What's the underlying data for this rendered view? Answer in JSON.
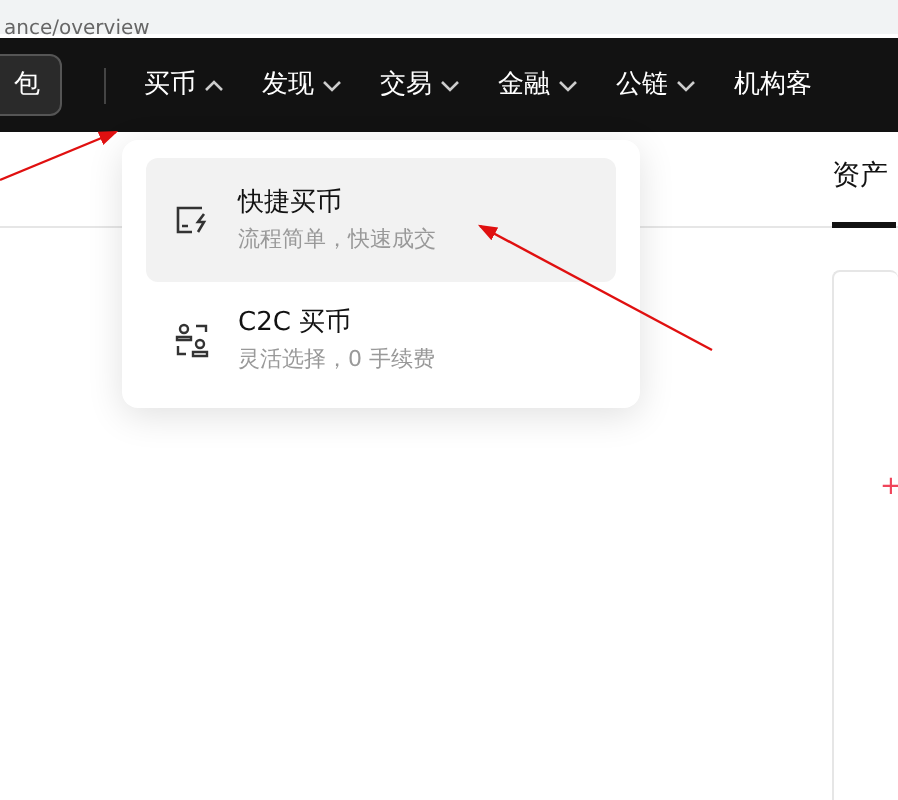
{
  "address_bar": {
    "url": "ance/overview"
  },
  "navbar": {
    "wallet_button": "包",
    "items": [
      {
        "label": "买币",
        "expanded": true
      },
      {
        "label": "发现",
        "expanded": false
      },
      {
        "label": "交易",
        "expanded": false
      },
      {
        "label": "金融",
        "expanded": false
      },
      {
        "label": "公链",
        "expanded": false
      },
      {
        "label": "机构客"
      }
    ]
  },
  "dropdown": {
    "items": [
      {
        "kind": "quick",
        "title": "快捷买币",
        "subtitle": "流程简单，快速成交",
        "selected": true
      },
      {
        "kind": "c2c",
        "title": "C2C 买币",
        "subtitle": "灵活选择，0 手续费",
        "selected": false
      }
    ]
  },
  "tabs": [
    {
      "label": "资产",
      "selected": true
    }
  ],
  "card": {
    "change_sign": "+"
  }
}
